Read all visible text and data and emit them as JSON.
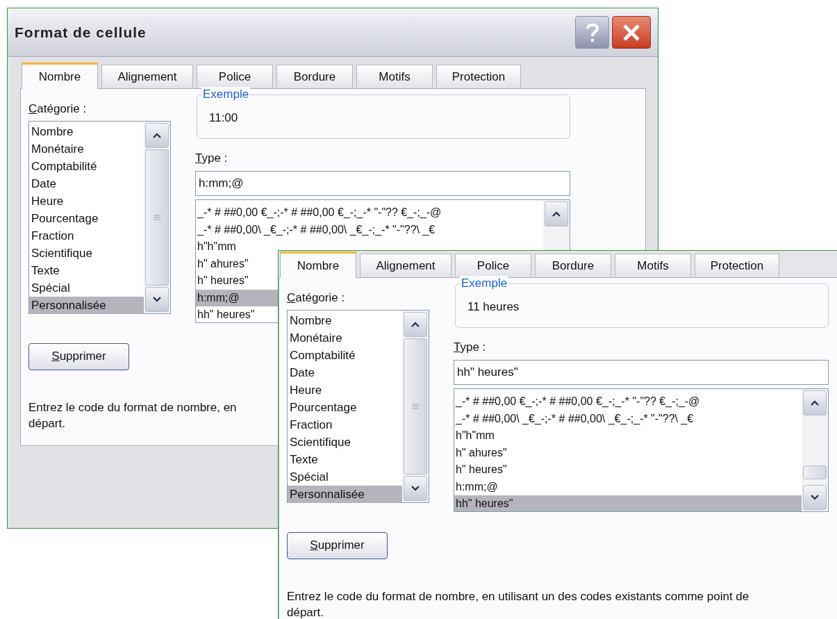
{
  "back_dialog": {
    "title": "Format de cellule",
    "tabs": [
      {
        "label": "Nombre",
        "selected": true
      },
      {
        "label": "Alignement",
        "selected": false
      },
      {
        "label": "Police",
        "selected": false
      },
      {
        "label": "Bordure",
        "selected": false
      },
      {
        "label": "Motifs",
        "selected": false
      },
      {
        "label": "Protection",
        "selected": false
      }
    ],
    "category_label": "Catégorie :",
    "categories": [
      {
        "label": "Nombre",
        "selected": false
      },
      {
        "label": "Monétaire",
        "selected": false
      },
      {
        "label": "Comptabilité",
        "selected": false
      },
      {
        "label": "Date",
        "selected": false
      },
      {
        "label": "Heure",
        "selected": false
      },
      {
        "label": "Pourcentage",
        "selected": false
      },
      {
        "label": "Fraction",
        "selected": false
      },
      {
        "label": "Scientifique",
        "selected": false
      },
      {
        "label": "Texte",
        "selected": false
      },
      {
        "label": "Spécial",
        "selected": false
      },
      {
        "label": "Personnalisée",
        "selected": true
      }
    ],
    "example_label": "Exemple",
    "example_value": "11:00",
    "type_label": "Type :",
    "type_value": "h:mm;@",
    "formats": [
      {
        "label": "_-* # ##0,00 €_-;-* # ##0,00 €_-;_-* \"-\"?? €_-;_-@",
        "selected": false
      },
      {
        "label": "_-* # ##0,00\\ _€_-;-* # ##0,00\\ _€_-;_-* \"-\"??\\ _€",
        "selected": false
      },
      {
        "label": "h\"h\"mm",
        "selected": false
      },
      {
        "label": "h\" ahures\"",
        "selected": false
      },
      {
        "label": "h\" heures\"",
        "selected": false
      },
      {
        "label": "h:mm;@",
        "selected": true
      },
      {
        "label": "hh\" heures\"",
        "selected": false
      }
    ],
    "delete_button": "Supprimer",
    "description_lines": [
      "Entrez le code du format de nombre, en",
      "départ."
    ]
  },
  "front_panel": {
    "tabs": [
      {
        "label": "Nombre",
        "selected": true
      },
      {
        "label": "Alignement",
        "selected": false
      },
      {
        "label": "Police",
        "selected": false
      },
      {
        "label": "Bordure",
        "selected": false
      },
      {
        "label": "Motifs",
        "selected": false
      },
      {
        "label": "Protection",
        "selected": false
      }
    ],
    "category_label": "Catégorie :",
    "categories": [
      {
        "label": "Nombre",
        "selected": false
      },
      {
        "label": "Monétaire",
        "selected": false
      },
      {
        "label": "Comptabilité",
        "selected": false
      },
      {
        "label": "Date",
        "selected": false
      },
      {
        "label": "Heure",
        "selected": false
      },
      {
        "label": "Pourcentage",
        "selected": false
      },
      {
        "label": "Fraction",
        "selected": false
      },
      {
        "label": "Scientifique",
        "selected": false
      },
      {
        "label": "Texte",
        "selected": false
      },
      {
        "label": "Spécial",
        "selected": false
      },
      {
        "label": "Personnalisée",
        "selected": true
      }
    ],
    "example_label": "Exemple",
    "example_value": "11 heures",
    "type_label": "Type :",
    "type_value": "hh\" heures\"",
    "formats": [
      {
        "label": "_-* # ##0,00 €_-;-* # ##0,00 €_-;_-* \"-\"?? €_-;_-@",
        "selected": false
      },
      {
        "label": "_-* # ##0,00\\ _€_-;-* # ##0,00\\ _€_-;_-* \"-\"??\\ _€",
        "selected": false
      },
      {
        "label": "h\"h\"mm",
        "selected": false
      },
      {
        "label": "h\" ahures\"",
        "selected": false
      },
      {
        "label": "h\" heures\"",
        "selected": false
      },
      {
        "label": "h:mm;@",
        "selected": false
      },
      {
        "label": "hh\" heures\"",
        "selected": true
      }
    ],
    "delete_button": "Supprimer",
    "description_lines": [
      "Entrez le code du format de nombre, en utilisant un des codes existants comme point de",
      "départ."
    ]
  }
}
